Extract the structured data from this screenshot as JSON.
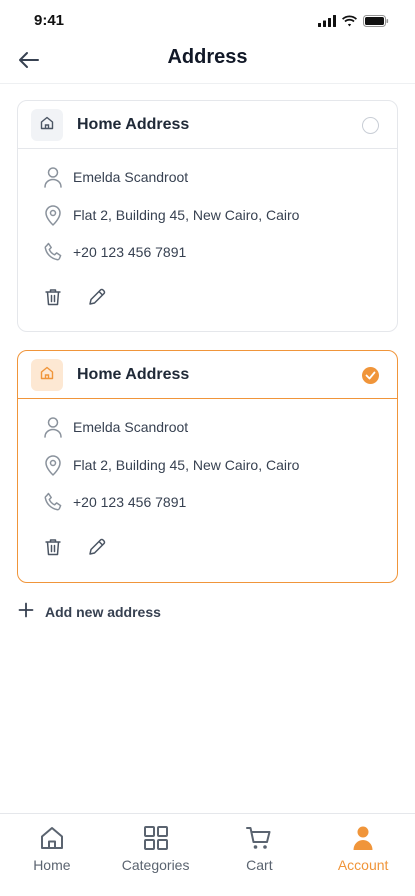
{
  "status": {
    "time": "9:41"
  },
  "header": {
    "title": "Address"
  },
  "addresses": [
    {
      "title": "Home Address",
      "name": "Emelda Scandroot",
      "address": "Flat 2, Building 45, New Cairo, Cairo",
      "phone": "+20 123 456 7891",
      "selected": false
    },
    {
      "title": "Home Address",
      "name": "Emelda Scandroot",
      "address": "Flat 2, Building 45, New Cairo, Cairo",
      "phone": "+20 123 456 7891",
      "selected": true
    }
  ],
  "add_address": {
    "label": "Add new address"
  },
  "tabbar": {
    "items": [
      {
        "label": "Home",
        "icon": "home-icon"
      },
      {
        "label": "Categories",
        "icon": "grid-icon"
      },
      {
        "label": "Cart",
        "icon": "cart-icon"
      },
      {
        "label": "Account",
        "icon": "user-icon",
        "active": true
      }
    ]
  },
  "colors": {
    "accent": "#f0953a",
    "text": "#1f2937",
    "muted": "#5b6470",
    "border": "#e5e7eb"
  }
}
